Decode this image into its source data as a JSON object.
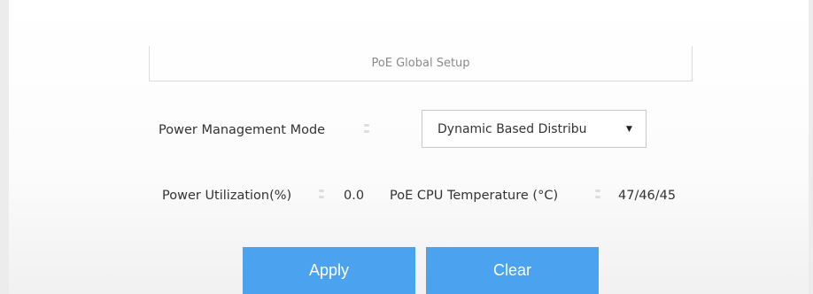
{
  "section": {
    "title": "PoE Global Setup"
  },
  "power_management": {
    "label": "Power Management Mode",
    "selected_value": "Dynamic Based Distribu",
    "dropdown_icon": "caret-down-icon"
  },
  "power_utilization": {
    "label": "Power Utilization(%)",
    "value": "0.0"
  },
  "cpu_temperature": {
    "label": "PoE CPU Temperature (°C)",
    "value": "47/46/45"
  },
  "actions": {
    "apply_label": "Apply",
    "clear_label": "Clear"
  },
  "colors": {
    "button": "#4ba3ef",
    "button_text": "#ffffff",
    "section_title_text": "#8a8a8a"
  }
}
